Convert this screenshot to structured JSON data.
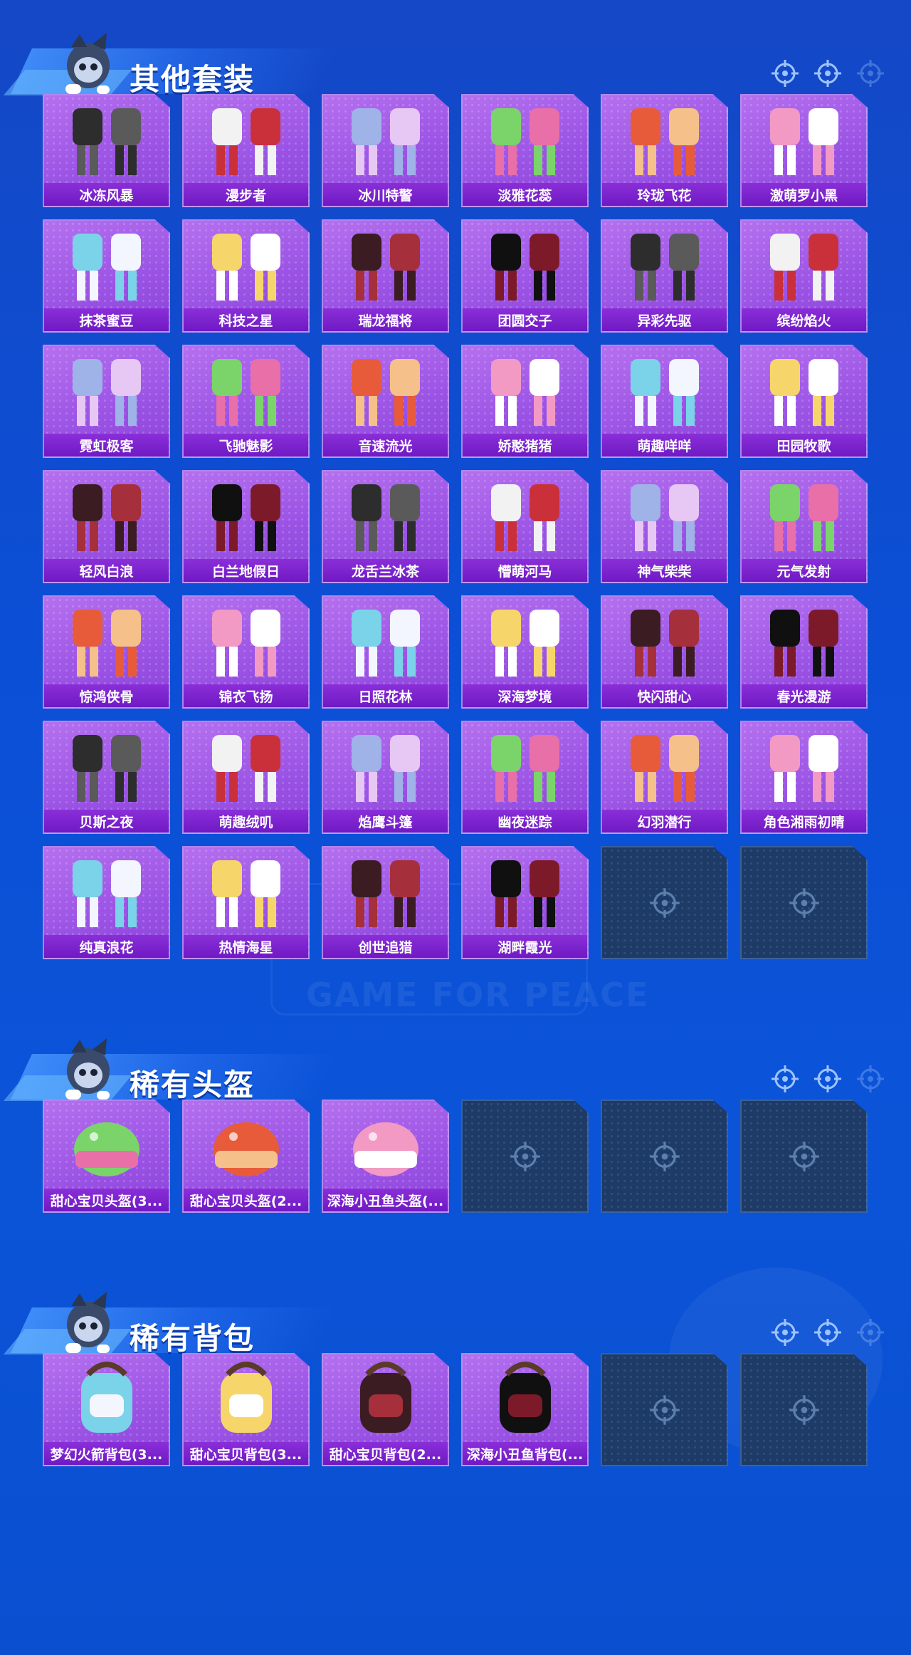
{
  "sections": [
    {
      "title": "其他套装",
      "items": [
        "冰冻风暴",
        "漫步者",
        "冰川特警",
        "淡雅花蕊",
        "玲珑飞花",
        "激萌罗小黑",
        "抹茶蜜豆",
        "科技之星",
        "瑞龙福将",
        "团圆交子",
        "异彩先驱",
        "缤纷焰火",
        "霓虹极客",
        "飞驰魅影",
        "音速流光",
        "娇憨猪猪",
        "萌趣咩咩",
        "田园牧歌",
        "轻风白浪",
        "白兰地假日",
        "龙舌兰冰茶",
        "懵萌河马",
        "神气柴柴",
        "元气发射",
        "惊鸿侠骨",
        "锦衣飞扬",
        "日照花林",
        "深海梦境",
        "快闪甜心",
        "春光漫游",
        "贝斯之夜",
        "萌趣绒叽",
        "焰鹰斗篷",
        "幽夜迷踪",
        "幻羽潜行",
        "角色湘雨初晴",
        "纯真浪花",
        "热情海星",
        "创世追猎",
        "湖畔霞光"
      ],
      "empty_slots": 2
    },
    {
      "title": "稀有头盔",
      "items": [
        "甜心宝贝头盔(3...",
        "甜心宝贝头盔(2...",
        "深海小丑鱼头盔(..."
      ],
      "empty_slots": 3
    },
    {
      "title": "稀有背包",
      "items": [
        "梦幻火箭背包(3...",
        "甜心宝贝背包(3...",
        "甜心宝贝背包(2...",
        "深海小丑鱼背包(..."
      ],
      "empty_slots": 2
    }
  ],
  "watermark": "GAME FOR PEACE",
  "colors": {
    "card_purple": "#a45ce8",
    "label_purple": "#7a22cc",
    "empty_slot": "#1d3b66",
    "background_blue": "#0b4fd6"
  },
  "icons": [
    "crosshair-icon",
    "mascot-icon",
    "outfit-icon",
    "helmet-icon",
    "backpack-icon"
  ]
}
